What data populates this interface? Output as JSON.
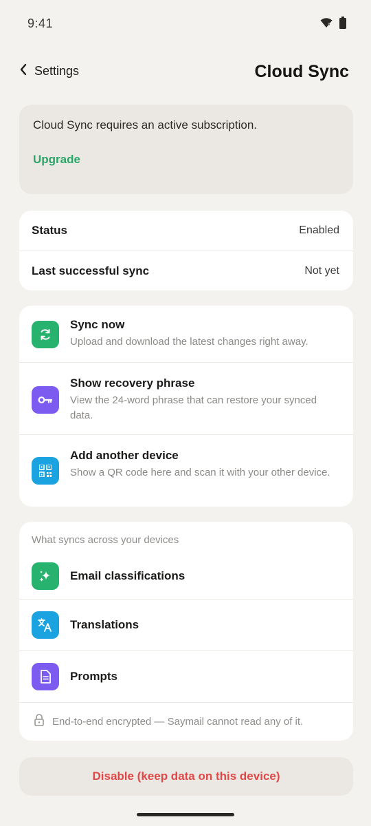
{
  "status_bar": {
    "time": "9:41"
  },
  "header": {
    "back_label": "Settings",
    "title": "Cloud Sync"
  },
  "banner": {
    "message": "Cloud Sync requires an active subscription.",
    "link_label": "Upgrade"
  },
  "status_card": {
    "rows": [
      {
        "key": "Status",
        "value": "Enabled"
      },
      {
        "key": "Last successful sync",
        "value": "Not yet"
      }
    ]
  },
  "actions": [
    {
      "title": "Sync now",
      "description": "Upload and download the latest changes right away.",
      "icon": "sync-icon",
      "color": "#27b36e"
    },
    {
      "title": "Show recovery phrase",
      "description": "View the 24-word phrase that can restore your synced data.",
      "icon": "key-icon",
      "color": "#7c5cf0"
    },
    {
      "title": "Add another device",
      "description": "Show a QR code here and scan it with your other device.",
      "icon": "qr-code-icon",
      "color": "#1aa3e0"
    }
  ],
  "syncs": {
    "caption": "What syncs across your devices",
    "items": [
      {
        "label": "Email classifications",
        "icon": "sparkle-icon",
        "color": "#27b36e"
      },
      {
        "label": "Translations",
        "icon": "translate-icon",
        "color": "#1aa3e0"
      },
      {
        "label": "Prompts",
        "icon": "document-icon",
        "color": "#7c5cf0"
      }
    ],
    "encryption_note": "End-to-end encrypted — Saymail cannot read any of it."
  },
  "disable_button": {
    "label": "Disable (keep data on this device)"
  },
  "colors": {
    "accent_green": "#2aa66a",
    "danger_red": "#e04848",
    "background": "#f4f2ee"
  }
}
